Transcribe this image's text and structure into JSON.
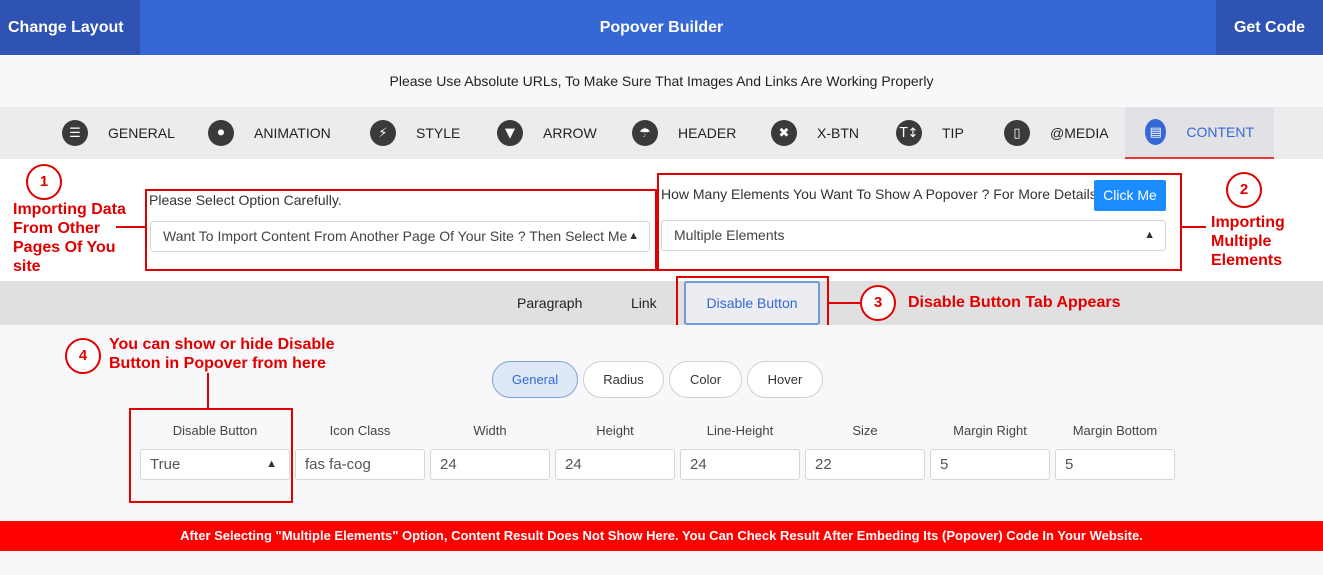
{
  "header": {
    "left_button": "Change Layout",
    "title": "Popover Builder",
    "right_button": "Get Code"
  },
  "notice": "Please Use Absolute URLs, To Make Sure That Images And Links Are Working Properly",
  "tabs": [
    {
      "label": "GENERAL",
      "icon": "list-icon"
    },
    {
      "label": "ANIMATION",
      "icon": "lightbulb-icon"
    },
    {
      "label": "STYLE",
      "icon": "bolt-icon"
    },
    {
      "label": "ARROW",
      "icon": "chevron-down-icon"
    },
    {
      "label": "HEADER",
      "icon": "umbrella-beach-icon"
    },
    {
      "label": "X-BTN",
      "icon": "close-icon"
    },
    {
      "label": "TIP",
      "icon": "text-height-icon"
    },
    {
      "label": "@MEDIA",
      "icon": "mobile-icon"
    },
    {
      "label": "CONTENT",
      "icon": "card-icon",
      "active": true
    }
  ],
  "import_section": {
    "label": "Please Select Option Carefully.",
    "select_value": "Want To Import Content From Another Page Of Your Site ? Then Select Me"
  },
  "elements_section": {
    "label": "How Many Elements You Want To Show A Popover ? For More Details",
    "button": "Click Me",
    "select_value": "Multiple Elements"
  },
  "annotations": {
    "n1": "1",
    "t1": "Importing Data From Other Pages Of You site",
    "n2": "2",
    "t2": "Importing Multiple Elements",
    "n3": "3",
    "t3": "Disable Button Tab Appears",
    "n4": "4",
    "t4": "You can show or hide Disable Button in Popover from here"
  },
  "subtabs": [
    {
      "label": "Paragraph"
    },
    {
      "label": "Link"
    },
    {
      "label": "Disable Button",
      "active": true
    }
  ],
  "pills": [
    {
      "label": "General",
      "active": true
    },
    {
      "label": "Radius"
    },
    {
      "label": "Color"
    },
    {
      "label": "Hover"
    }
  ],
  "fields": [
    {
      "label": "Disable Button",
      "value": "True",
      "type": "select"
    },
    {
      "label": "Icon Class",
      "value": "fas fa-cog"
    },
    {
      "label": "Width",
      "value": "24"
    },
    {
      "label": "Height",
      "value": "24"
    },
    {
      "label": "Line-Height",
      "value": "24"
    },
    {
      "label": "Size",
      "value": "22"
    },
    {
      "label": "Margin Right",
      "value": "5"
    },
    {
      "label": "Margin Bottom",
      "value": "5"
    }
  ],
  "footer": "After Selecting \"Multiple Elements\" Option, Content Result Does Not Show Here. You Can Check Result After Embeding Its (Popover) Code In Your Website.",
  "colors": {
    "header": "#3568d4",
    "header_dark": "#2f53b3",
    "annotation_red": "#e00000",
    "footer_red": "#ff0000",
    "accent_blue": "#1a8cff"
  }
}
